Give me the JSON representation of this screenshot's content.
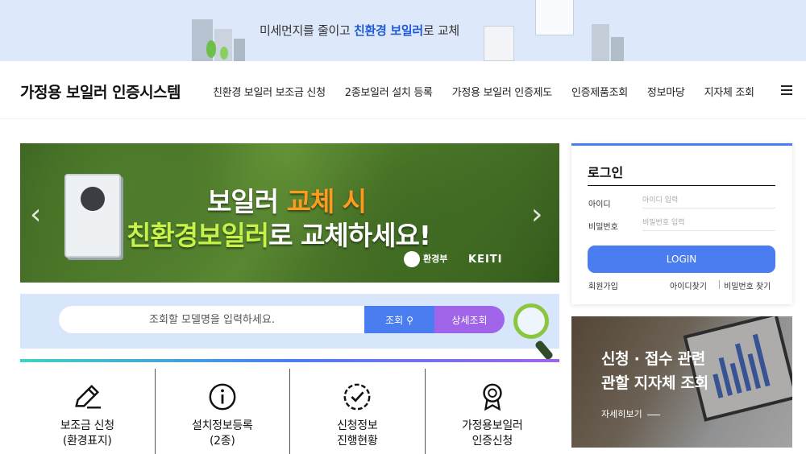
{
  "promo_banner": {
    "text_before": "미세먼지를 줄이고 ",
    "text_highlight": "친환경 보일러",
    "text_after": "로 교체"
  },
  "header": {
    "site_title": "가정용 보일러 인증시스템",
    "nav": [
      "친환경 보일러 보조금 신청",
      "2종보일러 설치 등록",
      "가정용 보일러 인증제도",
      "인증제품조회",
      "정보마당",
      "지자체 조회"
    ],
    "menu_icon": "hamburger-icon"
  },
  "hero": {
    "line1_white": "보일러 ",
    "line1_highlight": "교체 시",
    "line2_highlight": "친환경보일러",
    "line2_white": "로 교체하세요!",
    "ministry": "환경부",
    "keiti": "KEITI",
    "prev_icon": "chevron-left-icon",
    "next_icon": "chevron-right-icon"
  },
  "search": {
    "placeholder": "조회할 모델명을 입력하세요.",
    "search_label": "조회",
    "detail_label": "상세조회"
  },
  "quick_menu": [
    {
      "line1": "보조금 신청",
      "line2": "(환경표지)",
      "icon": "pencil-icon"
    },
    {
      "line1": "설치정보등록",
      "line2": "(2종)",
      "icon": "info-icon"
    },
    {
      "line1": "신청정보",
      "line2": "진행현황",
      "icon": "check-circle-icon"
    },
    {
      "line1": "가정용보일러",
      "line2": "인증신청",
      "icon": "award-badge-icon"
    }
  ],
  "login": {
    "title": "로그인",
    "id_label": "아이디",
    "id_placeholder": "아이디 입력",
    "pw_label": "비밀번호",
    "pw_placeholder": "비밀번호 입력",
    "button": "LOGIN",
    "signup": "회원가입",
    "find_id": "아이디찾기",
    "find_pw": "비밀번호 찾기"
  },
  "local_card": {
    "line1": "신청 · 접수 관련",
    "line2": "관할 지자체 조회",
    "more": "자세히보기"
  },
  "colors": {
    "brand_blue": "#4a7ef0",
    "brand_purple": "#9f64e8",
    "promo_bg": "#dde8fa",
    "search_bg": "#d7e6fb",
    "hero_orange": "#ff9a1f",
    "hero_green": "#c6f24a"
  }
}
